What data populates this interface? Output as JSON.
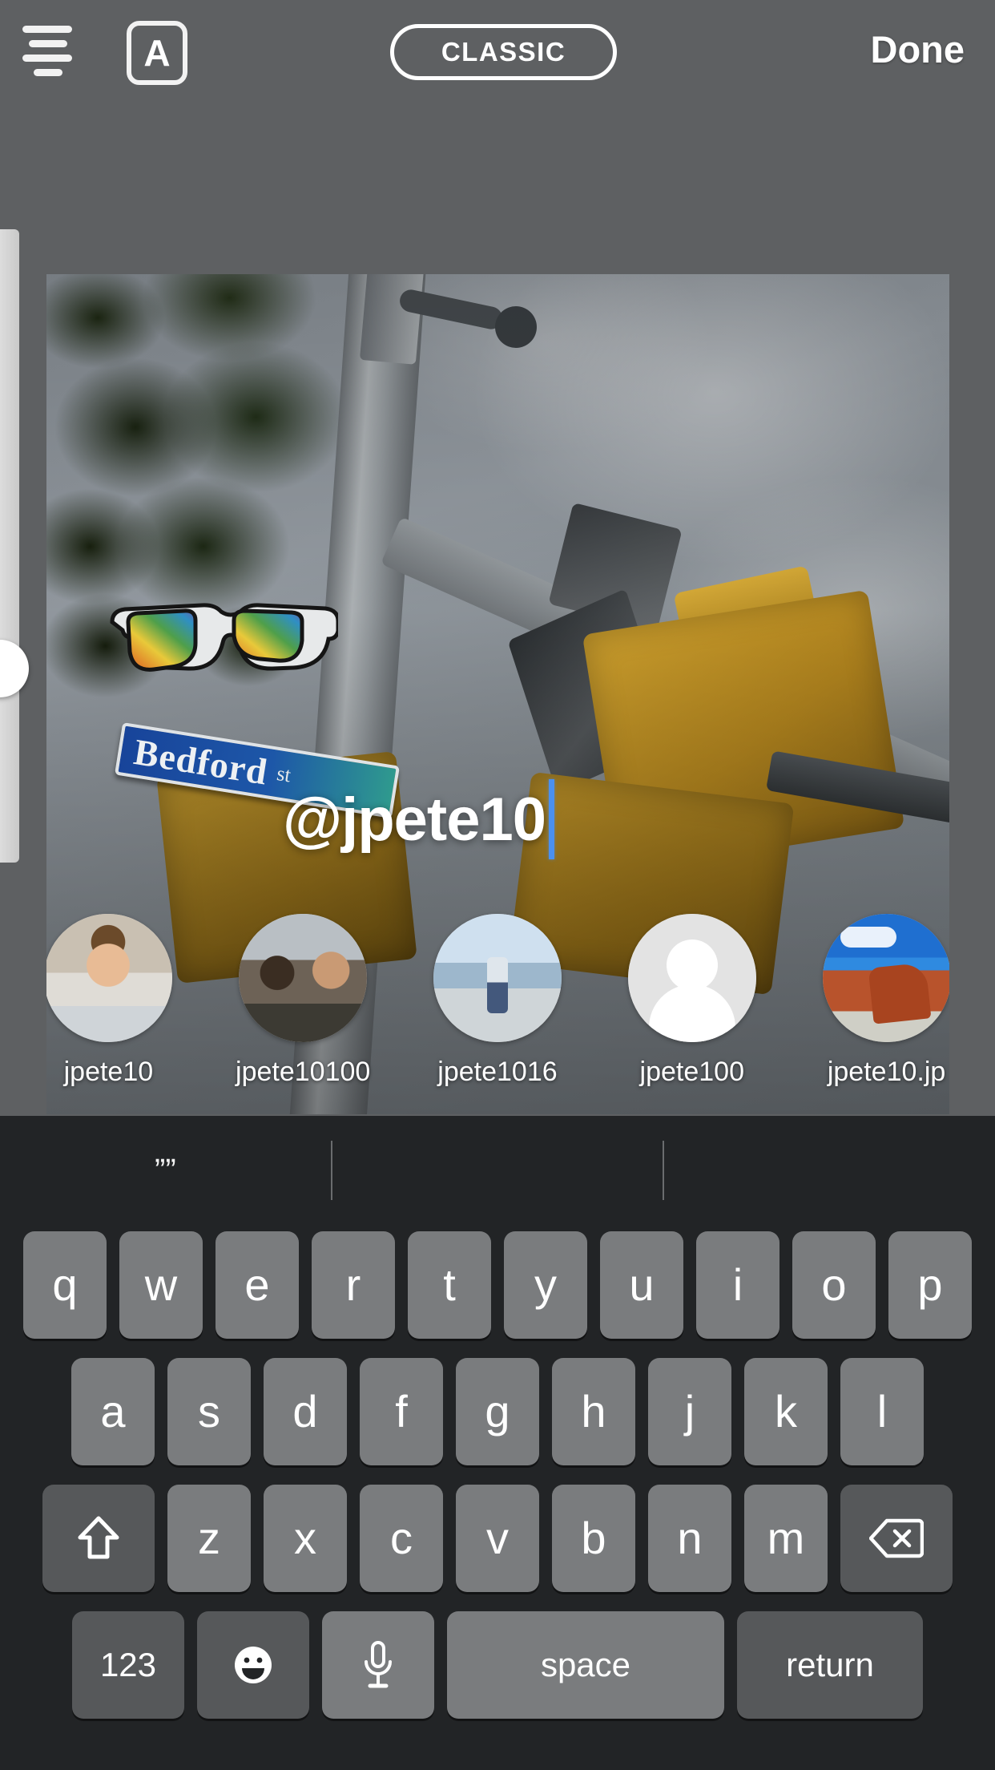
{
  "topbar": {
    "align_icon": "text-align-icon",
    "font_box_label": "A",
    "style_pill_label": "CLASSIC",
    "done_label": "Done"
  },
  "editor": {
    "size_slider": {
      "name": "text-size-slider",
      "value_position_pct": 65
    },
    "overlay_text": "@jpete10",
    "caret_color": "#4a90f0",
    "stickers": [
      {
        "name": "rainbow-sunglasses-sticker",
        "colors": [
          "#d23b34",
          "#e07b28",
          "#e8c93a",
          "#4f9f4a",
          "#2f8fc4",
          "#a32a8e"
        ]
      }
    ],
    "photo": {
      "street_sign_name": "Bedford",
      "street_sign_suffix": "st"
    }
  },
  "mention_suggestions": [
    {
      "username": "jpete10",
      "avatar": "avatar-man-glasses"
    },
    {
      "username": "jpete10100",
      "avatar": "avatar-two-people"
    },
    {
      "username": "jpete1016",
      "avatar": "avatar-ship-deck"
    },
    {
      "username": "jpete100",
      "avatar": "avatar-default-placeholder"
    },
    {
      "username": "jpete10.jp",
      "avatar": "avatar-red-rocks"
    }
  ],
  "keyboard": {
    "suggestions": [
      "””",
      "",
      ""
    ],
    "row1": [
      "q",
      "w",
      "e",
      "r",
      "t",
      "y",
      "u",
      "i",
      "o",
      "p"
    ],
    "row2": [
      "a",
      "s",
      "d",
      "f",
      "g",
      "h",
      "j",
      "k",
      "l"
    ],
    "row3_letters": [
      "z",
      "x",
      "c",
      "v",
      "b",
      "n",
      "m"
    ],
    "shift_icon": "shift-icon",
    "backspace_icon": "backspace-icon",
    "numbers_label": "123",
    "emoji_icon": "emoji-icon",
    "mic_icon": "microphone-icon",
    "space_label": "space",
    "return_label": "return"
  },
  "colors": {
    "background": "#5e6062",
    "keyboard_bg": "#222426",
    "key_light": "#7a7c7e",
    "key_dark": "#56585a",
    "accent_caret": "#4a90f0"
  }
}
